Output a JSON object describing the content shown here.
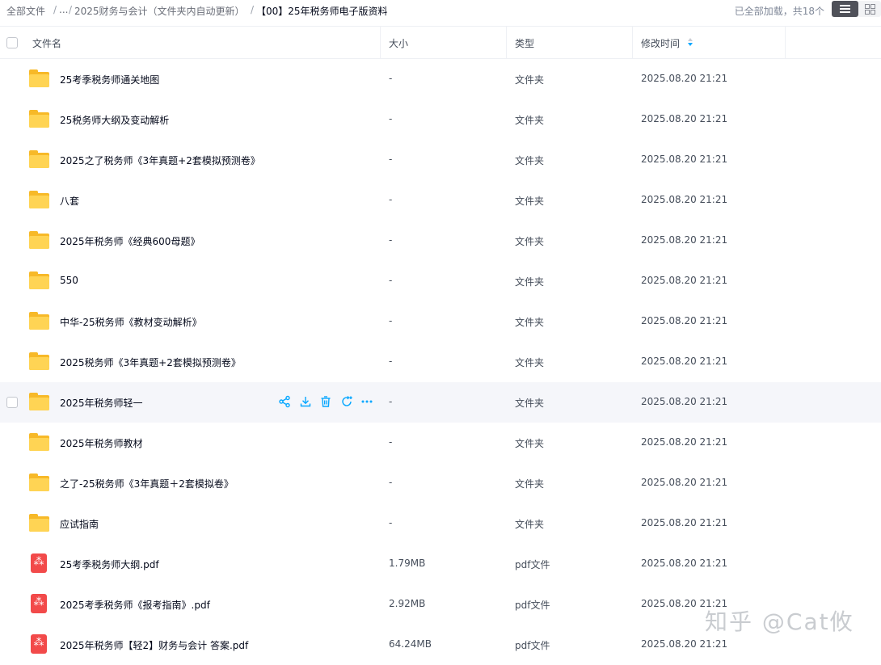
{
  "breadcrumb": {
    "root": "全部文件",
    "ellipsis": "...",
    "parent": "2025财务与会计（文件夹内自动更新）",
    "current": "【00】25年税务师电子版资料",
    "separator": "/"
  },
  "status": {
    "loaded_text": "已全部加载，共18个"
  },
  "view": {
    "list_icon": "list-view-icon",
    "grid_icon": "grid-view-icon"
  },
  "columns": {
    "name": "文件名",
    "size": "大小",
    "type": "类型",
    "modified": "修改时间"
  },
  "accent_color": "#06a7ff",
  "rows": [
    {
      "kind": "folder",
      "name": "25考季税务师通关地图",
      "size": "-",
      "type": "文件夹",
      "modified": "2025.08.20 21:21"
    },
    {
      "kind": "folder",
      "name": "25税务师大纲及变动解析",
      "size": "-",
      "type": "文件夹",
      "modified": "2025.08.20 21:21"
    },
    {
      "kind": "folder",
      "name": "2025之了税务师《3年真题+2套模拟预测卷》",
      "size": "-",
      "type": "文件夹",
      "modified": "2025.08.20 21:21"
    },
    {
      "kind": "folder",
      "name": "八套",
      "size": "-",
      "type": "文件夹",
      "modified": "2025.08.20 21:21"
    },
    {
      "kind": "folder",
      "name": "2025年税务师《经典600母题》",
      "size": "-",
      "type": "文件夹",
      "modified": "2025.08.20 21:21"
    },
    {
      "kind": "folder",
      "name": "550",
      "size": "-",
      "type": "文件夹",
      "modified": "2025.08.20 21:21"
    },
    {
      "kind": "folder",
      "name": "中华-25税务师《教材变动解析》",
      "size": "-",
      "type": "文件夹",
      "modified": "2025.08.20 21:21"
    },
    {
      "kind": "folder",
      "name": "2025税务师《3年真题+2套模拟预测卷》",
      "size": "-",
      "type": "文件夹",
      "modified": "2025.08.20 21:21"
    },
    {
      "kind": "folder",
      "name": "2025年税务师轻一",
      "size": "-",
      "type": "文件夹",
      "modified": "2025.08.20 21:21",
      "hover": true
    },
    {
      "kind": "folder",
      "name": "2025年税务师教材",
      "size": "-",
      "type": "文件夹",
      "modified": "2025.08.20 21:21"
    },
    {
      "kind": "folder",
      "name": "之了-25税务师《3年真题＋2套模拟卷》",
      "size": "-",
      "type": "文件夹",
      "modified": "2025.08.20 21:21"
    },
    {
      "kind": "folder",
      "name": "应试指南",
      "size": "-",
      "type": "文件夹",
      "modified": "2025.08.20 21:21"
    },
    {
      "kind": "pdf",
      "name": "25考季税务师大纲.pdf",
      "size": "1.79MB",
      "type": "pdf文件",
      "modified": "2025.08.20 21:21"
    },
    {
      "kind": "pdf",
      "name": "2025考季税务师《报考指南》.pdf",
      "size": "2.92MB",
      "type": "pdf文件",
      "modified": "2025.08.20 21:21"
    },
    {
      "kind": "pdf",
      "name": "2025年税务师【轻2】财务与会计 答案.pdf",
      "size": "64.24MB",
      "type": "pdf文件",
      "modified": "2025.08.20 21:21"
    }
  ],
  "row_actions": [
    {
      "name": "share-icon",
      "color": "#06a7ff"
    },
    {
      "name": "download-icon",
      "color": "#06a7ff"
    },
    {
      "name": "delete-icon",
      "color": "#06a7ff"
    },
    {
      "name": "sync-icon",
      "color": "#06a7ff"
    },
    {
      "name": "more-icon",
      "color": "#06a7ff"
    }
  ],
  "watermark": "知乎 @Cat攸"
}
